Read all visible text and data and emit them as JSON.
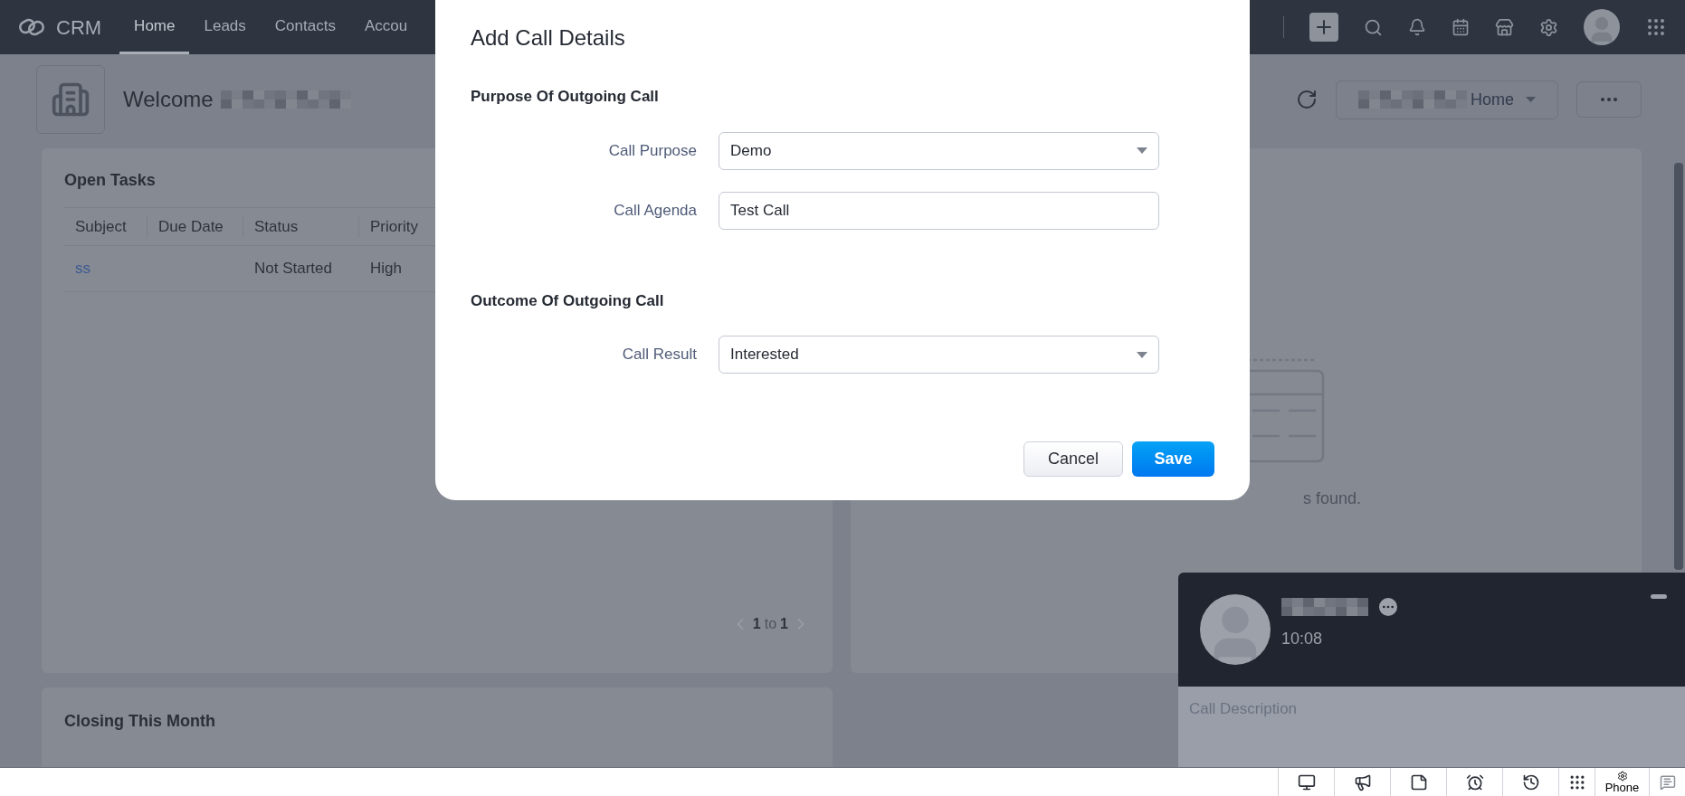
{
  "nav": {
    "logo": "CRM",
    "tabs": [
      {
        "label": "Home",
        "selected": true
      },
      {
        "label": "Leads",
        "selected": false
      },
      {
        "label": "Contacts",
        "selected": false
      },
      {
        "label": "Accou",
        "selected": false
      }
    ]
  },
  "header": {
    "welcome": "Welcome",
    "view_selector": "Home"
  },
  "open_tasks": {
    "title": "Open Tasks",
    "columns": [
      "Subject",
      "Due Date",
      "Status",
      "Priority"
    ],
    "rows": [
      {
        "subject": "ss",
        "status": "Not Started",
        "priority": "High"
      }
    ],
    "pagination": {
      "from": "1",
      "word": "to",
      "to": "1"
    }
  },
  "empty_state": {
    "message": "s found."
  },
  "closing": {
    "title": "Closing This Month"
  },
  "dialog": {
    "title": "Add Call Details",
    "sections": [
      {
        "title": "Purpose Of Outgoing Call",
        "fields": [
          {
            "label": "Call Purpose",
            "kind": "select",
            "value": "Demo"
          },
          {
            "label": "Call Agenda",
            "kind": "text",
            "value": "Test Call"
          }
        ]
      },
      {
        "title": "Outcome Of Outgoing Call",
        "fields": [
          {
            "label": "Call Result",
            "kind": "select",
            "value": "Interested"
          }
        ]
      }
    ],
    "buttons": [
      {
        "label": "Cancel",
        "kind": "secondary"
      },
      {
        "label": "Save",
        "kind": "primary"
      }
    ]
  },
  "call": {
    "duration": "10:08",
    "description_placeholder": "Call Description"
  },
  "dock": {
    "phone_label": "Phone"
  }
}
